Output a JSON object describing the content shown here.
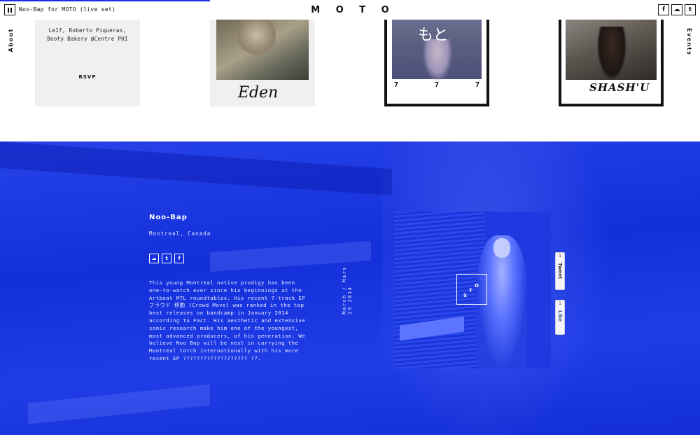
{
  "player": {
    "now_playing": "Noo-Bap for MOTO (live set)",
    "progress": 0.3
  },
  "header": {
    "logo": "M O T O",
    "social": [
      "f",
      "☁",
      "t"
    ],
    "about": "About",
    "events": "Events"
  },
  "cards": {
    "card1_names_line1": "Le1f, Roberto Piqueras,",
    "card1_names_line2": "Booty Bakery @Centre PHI",
    "card1_rsvp": "RSVP",
    "card2_signature": "Eden",
    "card3_jp": "もと",
    "card3_marks": [
      "7",
      "7",
      "7"
    ],
    "card4_signature": "SHASH'U"
  },
  "artist": {
    "name": "Noo-Bap",
    "location": "Montreal, Canada",
    "social": [
      "☁",
      "t",
      "f"
    ],
    "bio": "This young Montreal native prodigy has been one-to-watch ever since his beginnings at the Artbeat MTL roundtables. His recent 7-track EP フラウド 移動 (Crowd Move) was ranked in the top best releases on bandcamp in January 2014 according to Fact. His aesthetic and extensive sonic research make him one of the youngest, most advanced producers, of his generation. We believe Noo Bap will be next in carrying the Montreal torch internationally with his more recent EP ??????????????????? ??.",
    "date_line1": "March / Mars",
    "date_line2": "29 2014"
  },
  "moto_mark": {
    "s": "S",
    "t": "T",
    "o": "O"
  },
  "share": {
    "tweet_label": "Tweet",
    "tweet_count": "1",
    "like_label": "Like",
    "like_count": "1"
  },
  "colors": {
    "accent_blue": "#1432e6",
    "text_dark": "#111111",
    "card_bg": "#f0f0f0"
  }
}
